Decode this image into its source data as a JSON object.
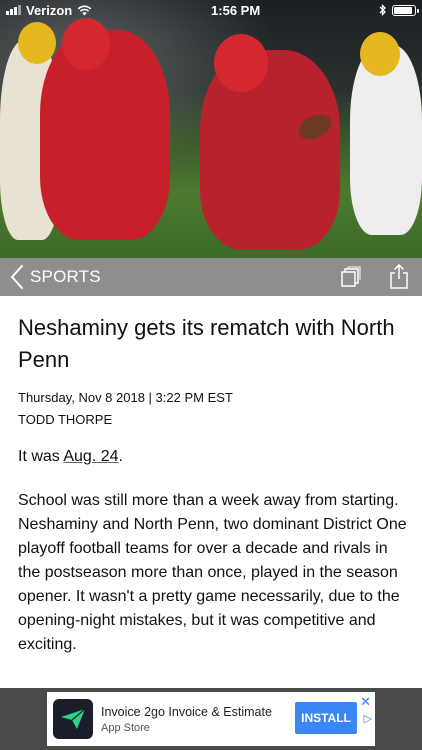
{
  "status_bar": {
    "carrier": "Verizon",
    "time": "1:56 PM"
  },
  "section_bar": {
    "label": "SPORTS",
    "icons": [
      "chevron-left-icon",
      "copy-pages-icon",
      "share-icon"
    ]
  },
  "article": {
    "headline": "Neshaminy gets its rematch with North Penn",
    "dateline": "Thursday, Nov 8 2018 | 3:22 PM EST",
    "author": "TODD THORPE",
    "intro_prefix": "It was ",
    "intro_link": "Aug. 24",
    "intro_suffix": ".",
    "paragraph": "School was still more than a week away from starting. Neshaminy and North Penn, two dominant District One playoff football teams for over a decade and rivals in the postseason more than once, played in the season opener. It wasn't a pretty game necessarily, due to the opening-night mistakes, but it was competitive and exciting."
  },
  "ad": {
    "title": "Invoice 2go Invoice & Estimate",
    "subtitle": "App Store",
    "cta": "INSTALL",
    "close": "✕",
    "adchoices": "▷"
  },
  "colors": {
    "section_bar_bg": "#8e8e8e",
    "ad_band_bg": "#4a4a4a",
    "install_button": "#3a86f4"
  }
}
